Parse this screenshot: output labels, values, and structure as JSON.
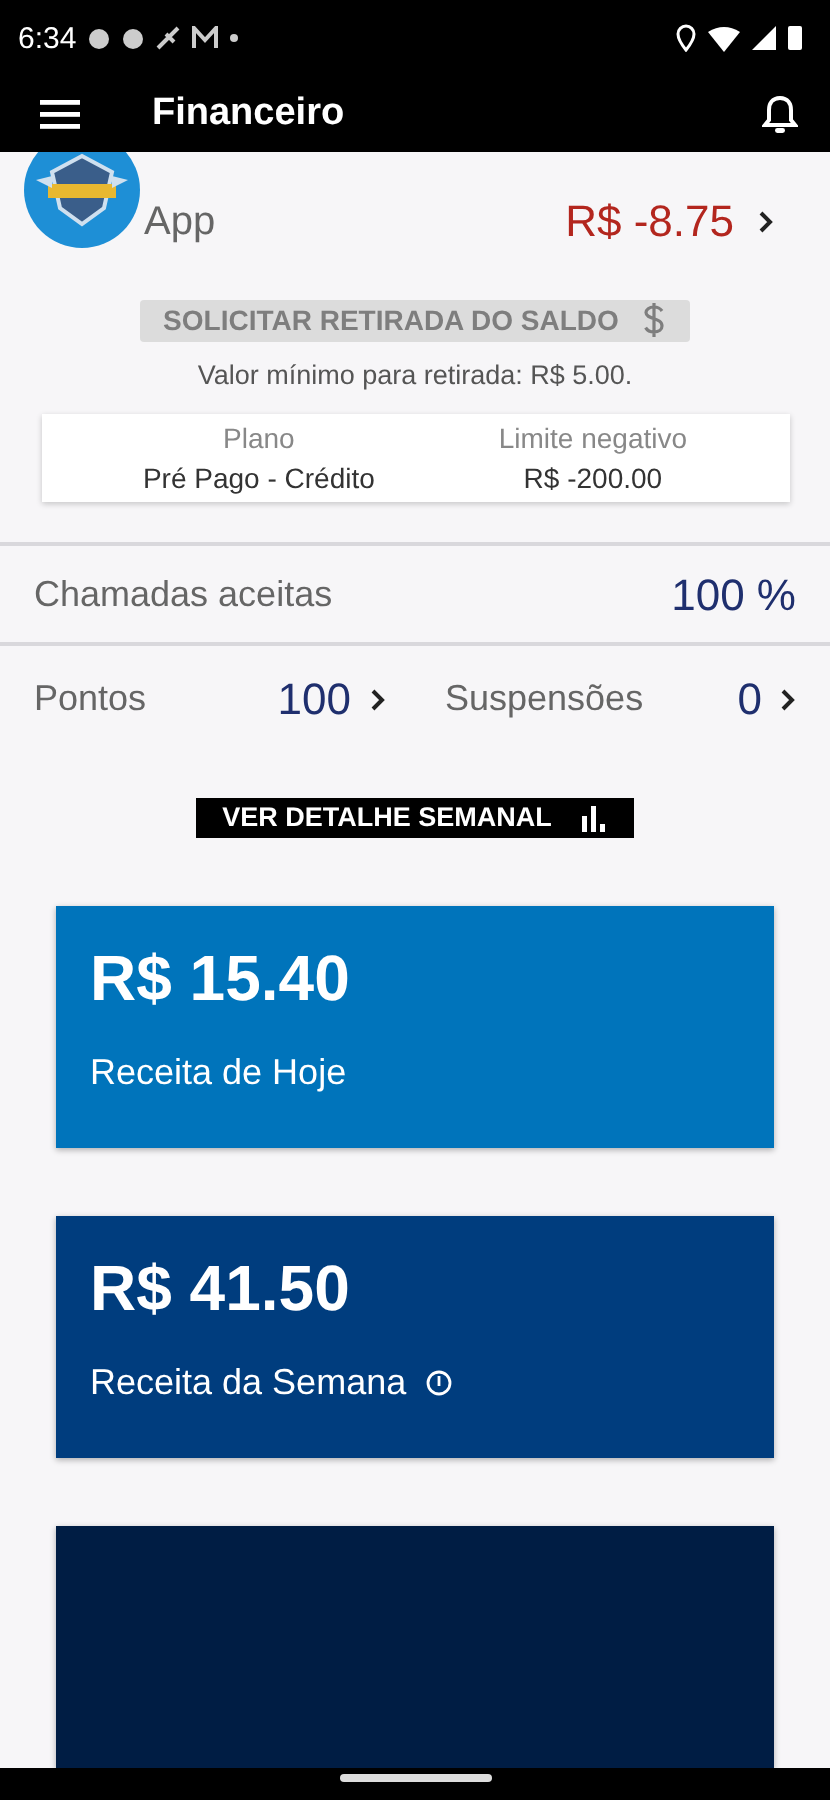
{
  "status_bar": {
    "time": "6:34"
  },
  "app_bar": {
    "title": "Financeiro"
  },
  "balance": {
    "label": "App",
    "amount": "R$ -8.75",
    "negative": true
  },
  "withdraw_button": {
    "label": "SOLICITAR RETIRADA DO SALDO",
    "disabled": true
  },
  "minimum_note": "Valor mínimo para retirada: R$ 5.00.",
  "plan_card": [
    {
      "label": "Plano",
      "value": "Pré Pago - Crédito"
    },
    {
      "label": "Limite negativo",
      "value": "R$ -200.00"
    }
  ],
  "accepted_calls": {
    "label": "Chamadas aceitas",
    "value": "100 %"
  },
  "stats": [
    {
      "label": "Pontos",
      "value": "100"
    },
    {
      "label": "Suspensões",
      "value": "0"
    }
  ],
  "weekly_button": {
    "label": "VER DETALHE SEMANAL"
  },
  "cards": [
    {
      "amount": "R$ 15.40",
      "label": "Receita de Hoje",
      "info": false,
      "color": "#0074bb"
    },
    {
      "amount": "R$ 41.50",
      "label": "Receita da Semana",
      "info": true,
      "color": "#003d7e"
    },
    {
      "color": "#001d44"
    }
  ]
}
